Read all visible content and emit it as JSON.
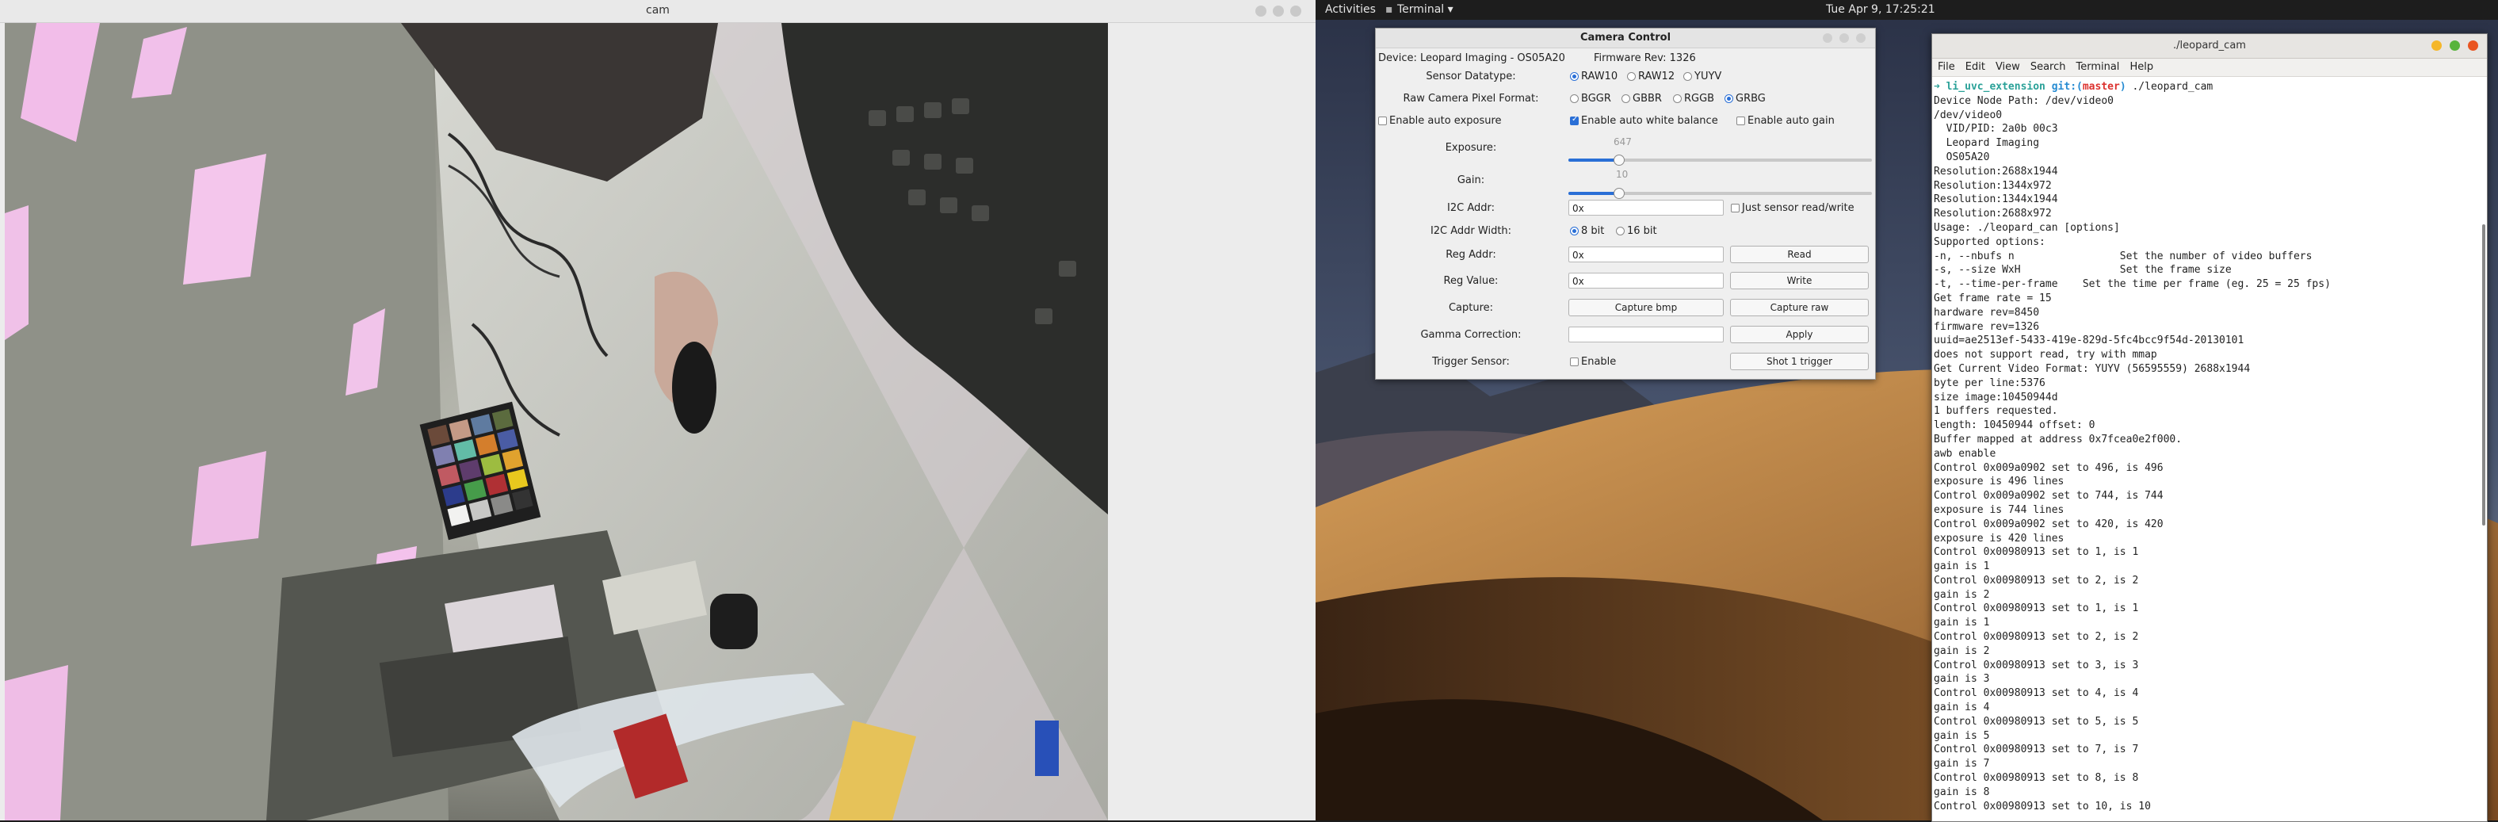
{
  "cam_window": {
    "title": "cam"
  },
  "topbar": {
    "activities": "Activities",
    "app_menu": "Terminal ▾",
    "clock": "Tue Apr 9, 17:25:21"
  },
  "camera_control": {
    "title": "Camera Control",
    "device": "Device: Leopard Imaging - OS05A20",
    "firmware": "Firmware Rev: 1326",
    "sensor_datatype_label": "Sensor Datatype:",
    "sensor_datatype_options": [
      "RAW10",
      "RAW12",
      "YUYV"
    ],
    "sensor_datatype_selected": "RAW10",
    "pixel_format_label": "Raw Camera Pixel Format:",
    "pixel_format_options": [
      "BGGR",
      "GBBR",
      "RGGB",
      "GRBG"
    ],
    "pixel_format_selected": "GRBG",
    "auto_exposure_label": "Enable auto exposure",
    "auto_white_balance_label": "Enable auto white balance",
    "auto_gain_label": "Enable auto gain",
    "auto_exposure": false,
    "auto_white_balance": true,
    "auto_gain": false,
    "exposure_label": "Exposure:",
    "exposure_value": "647",
    "exposure_fraction": 0.17,
    "gain_label": "Gain:",
    "gain_value": "10",
    "gain_fraction": 0.17,
    "i2c_addr_label": "I2C Addr:",
    "i2c_addr_value": "0x",
    "just_sensor_label": "Just sensor read/write",
    "i2c_width_label": "I2C Addr Width:",
    "i2c_width_options": [
      "8 bit",
      "16 bit"
    ],
    "i2c_width_selected": "8 bit",
    "reg_addr_label": "Reg Addr:",
    "reg_addr_value": "0x",
    "read_button": "Read",
    "reg_value_label": "Reg Value:",
    "reg_value_value": "0x",
    "write_button": "Write",
    "capture_label": "Capture:",
    "capture_bmp_button": "Capture bmp",
    "capture_raw_button": "Capture raw",
    "gamma_label": "Gamma Correction:",
    "gamma_value": "",
    "apply_button": "Apply",
    "trigger_label": "Trigger Sensor:",
    "trigger_enable_label": "Enable",
    "shot_trigger_button": "Shot 1 trigger"
  },
  "terminal": {
    "title": "./leopard_cam",
    "menu": [
      "File",
      "Edit",
      "View",
      "Search",
      "Terminal",
      "Help"
    ],
    "prompt": {
      "arrow": "➜",
      "repo": "li_uvc_extension",
      "git": "git:(",
      "branch": "master",
      "close": ")",
      "command": "./leopard_cam"
    },
    "lines": [
      "Device Node Path: /dev/video0",
      "/dev/video0",
      "  VID/PID: 2a0b 00c3",
      "  Leopard Imaging",
      "  OS05A20",
      "Resolution:2688x1944",
      "Resolution:1344x972",
      "Resolution:1344x1944",
      "Resolution:2688x972",
      "Usage: ./leopard_can [options]",
      "Supported options:",
      "-n, --nbufs n                 Set the number of video buffers",
      "-s, --size WxH                Set the frame size",
      "-t, --time-per-frame    Set the time per frame (eg. 25 = 25 fps)",
      "Get frame rate = 15",
      "hardware rev=8450",
      "firmware rev=1326",
      "uuid=ae2513ef-5433-419e-829d-5fc4bcc9f54d-20130101",
      "does not support read, try with mmap",
      "Get Current Video Format: YUYV (56595559) 2688x1944",
      "byte per line:5376",
      "size image:10450944d",
      "1 buffers requested.",
      "length: 10450944 offset: 0",
      "Buffer mapped at address 0x7fcea0e2f000.",
      "awb enable",
      "Control 0x009a0902 set to 496, is 496",
      "exposure is 496 lines",
      "Control 0x009a0902 set to 744, is 744",
      "exposure is 744 lines",
      "Control 0x009a0902 set to 420, is 420",
      "exposure is 420 lines",
      "Control 0x00980913 set to 1, is 1",
      "gain is 1",
      "Control 0x00980913 set to 2, is 2",
      "gain is 2",
      "Control 0x00980913 set to 1, is 1",
      "gain is 1",
      "Control 0x00980913 set to 2, is 2",
      "gain is 2",
      "Control 0x00980913 set to 3, is 3",
      "gain is 3",
      "Control 0x00980913 set to 4, is 4",
      "gain is 4",
      "Control 0x00980913 set to 5, is 5",
      "gain is 5",
      "Control 0x00980913 set to 7, is 7",
      "gain is 7",
      "Control 0x00980913 set to 8, is 8",
      "gain is 8",
      "Control 0x00980913 set to 10, is 10"
    ]
  },
  "colors": {
    "accent": "#2a6fd6",
    "terminal_close": "#e95420",
    "terminal_max": "#58b43b",
    "terminal_min": "#f5b72a"
  }
}
